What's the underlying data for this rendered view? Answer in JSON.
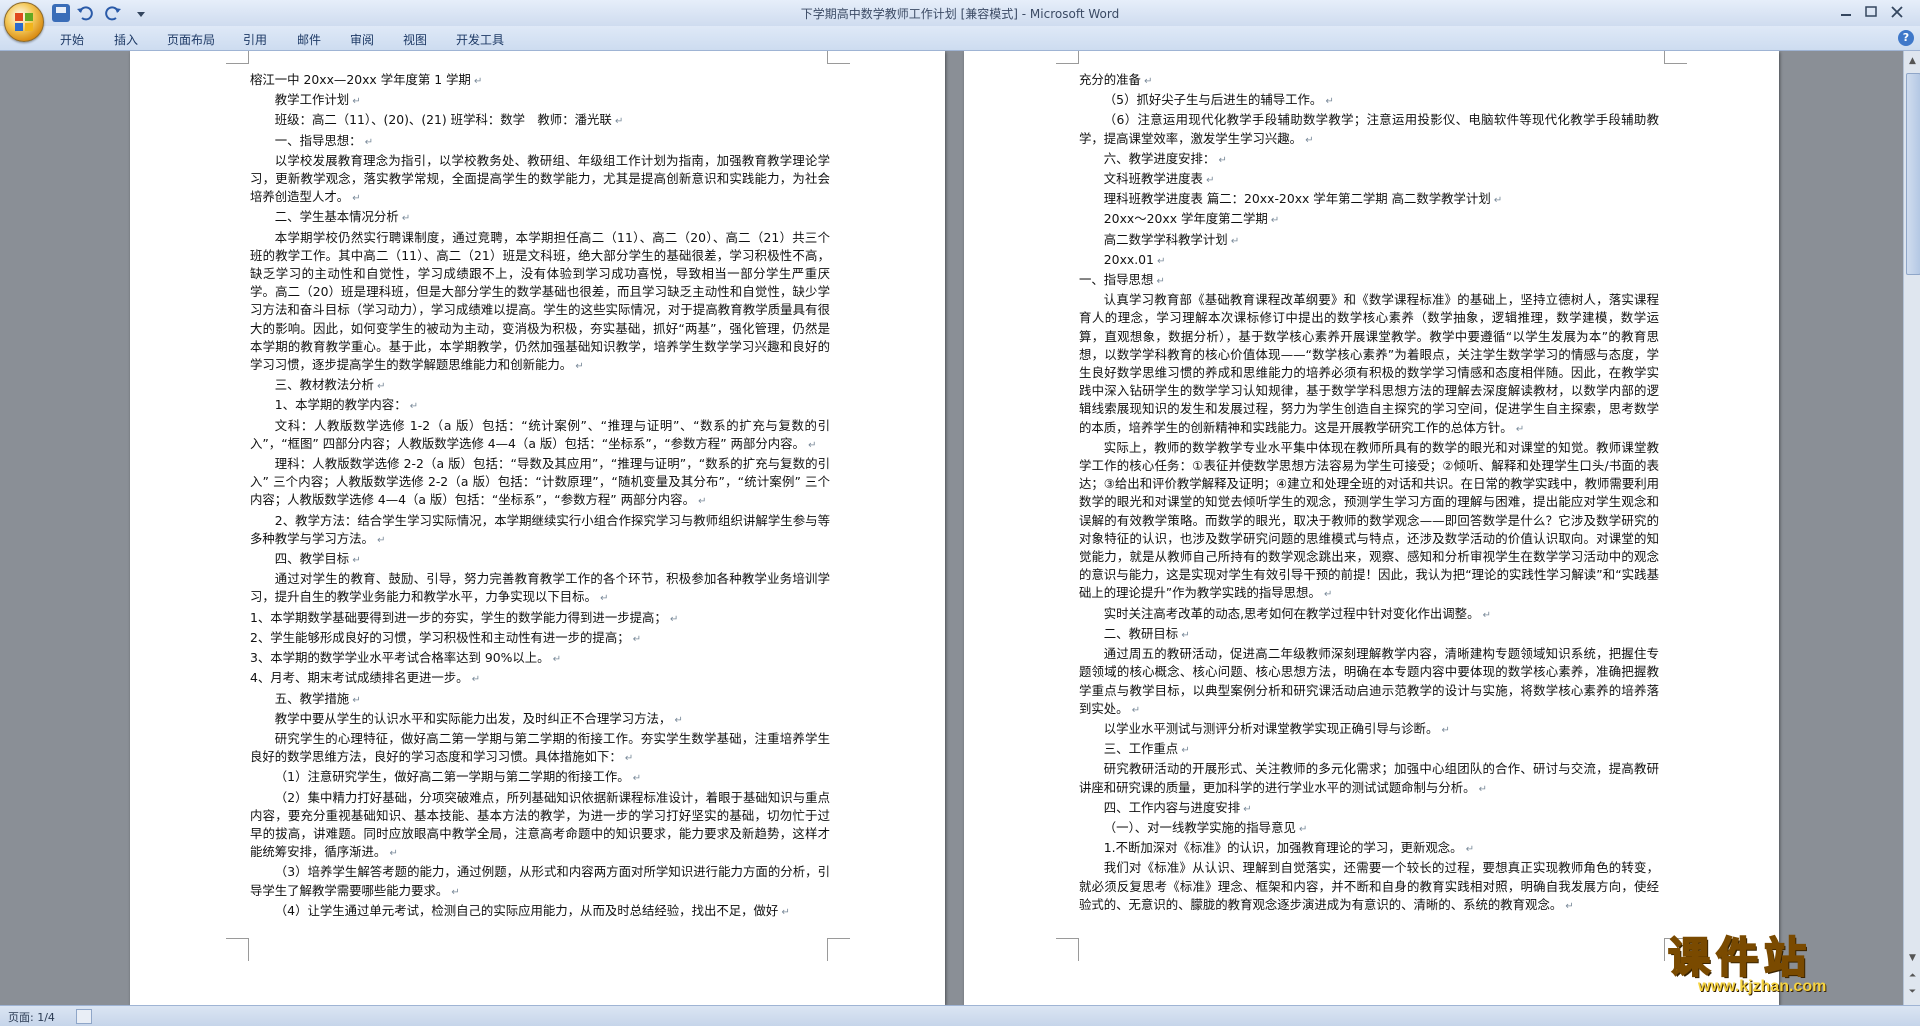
{
  "window": {
    "title": "下学期高中数学教师工作计划 [兼容模式] - Microsoft Word"
  },
  "ribbon": {
    "tabs": [
      "开始",
      "插入",
      "页面布局",
      "引用",
      "邮件",
      "审阅",
      "视图",
      "开发工具"
    ]
  },
  "status": {
    "page": "页面: 1/4"
  },
  "watermark": {
    "main": "课件站",
    "sub": "www.kjzhan.com"
  },
  "page1": [
    {
      "t": "榕江一中 20xx—20xx 学年度第 1 学期",
      "i": false
    },
    {
      "t": "教学工作计划",
      "i": true
    },
    {
      "t": "班级：高二（11）、(20)、(21) 班学科：数学　教师：潘光联",
      "i": true
    },
    {
      "t": "一、指导思想：",
      "i": true
    },
    {
      "t": "以学校发展教育理念为指引，以学校教务处、教研组、年级组工作计划为指南，加强教育教学理论学习，更新教学观念，落实教学常规，全面提高学生的数学能力，尤其是提高创新意识和实践能力，为社会培养创造型人才。",
      "i": true
    },
    {
      "t": "二、学生基本情况分析",
      "i": true
    },
    {
      "t": "本学期学校仍然实行聘课制度，通过竞聘，本学期担任高二（11）、高二（20）、高二（21）共三个班的教学工作。其中高二（11）、高二（21）班是文科班，绝大部分学生的基础很差，学习积极性不高，缺乏学习的主动性和自觉性，学习成绩跟不上，没有体验到学习成功喜悦，导致相当一部分学生严重厌学。高二（20）班是理科班，但是大部分学生的数学基础也很差，而且学习缺乏主动性和自觉性，缺少学习方法和奋斗目标（学习动力），学习成绩难以提高。学生的这些实际情况，对于提高教育教学质量具有很大的影响。因此，如何变学生的被动为主动，变消极为积极，夯实基础，抓好“两基”，强化管理，仍然是本学期的教育教学重心。基于此，本学期教学，仍然加强基础知识教学，培养学生数学学习兴趣和良好的学习习惯，逐步提高学生的数学解题思维能力和创新能力。",
      "i": true
    },
    {
      "t": "三、教材教法分析",
      "i": true
    },
    {
      "t": "1、本学期的教学内容：",
      "i": true
    },
    {
      "t": "文科：人教版数学选修 1-2（a 版）包括：“统计案例”、“推理与证明”、“数系的扩充与复数的引入”，“框图” 四部分内容；人教版数学选修 4—4（a 版）包括：“坐标系”，“参数方程” 两部分内容。",
      "i": true
    },
    {
      "t": "理科：人教版数学选修 2-2（a 版）包括：“导数及其应用”，“推理与证明”，“数系的扩充与复数的引入” 三个内容；人教版数学选修 2-2（a 版）包括：“计数原理”，“随机变量及其分布”，“统计案例” 三个内容；人教版数学选修 4—4（a 版）包括：“坐标系”，“参数方程” 两部分内容。",
      "i": true
    },
    {
      "t": "2、教学方法：结合学生学习实际情况，本学期继续实行小组合作探究学习与教师组织讲解学生参与等多种教学与学习方法。",
      "i": true
    },
    {
      "t": "四、教学目标",
      "i": true
    },
    {
      "t": "通过对学生的教育、鼓励、引导，努力完善教育教学工作的各个环节，积极参加各种教学业务培训学习，提升自生的教学业务能力和教学水平，力争实现以下目标。",
      "i": true
    },
    {
      "t": "1、本学期数学基础要得到进一步的夯实，学生的数学能力得到进一步提高；",
      "i": false
    },
    {
      "t": "2、学生能够形成良好的习惯，学习积极性和主动性有进一步的提高；",
      "i": false
    },
    {
      "t": "3、本学期的数学学业水平考试合格率达到 90%以上。",
      "i": false
    },
    {
      "t": "4、月考、期末考试成绩排名更进一步。",
      "i": false
    },
    {
      "t": "五、教学措施",
      "i": true
    },
    {
      "t": "教学中要从学生的认识水平和实际能力出发，及时纠正不合理学习方法，",
      "i": true
    },
    {
      "t": "研究学生的心理特征，做好高二第一学期与第二学期的衔接工作。夯实学生数学基础，注重培养学生良好的数学思维方法，良好的学习态度和学习习惯。具体措施如下：",
      "i": true
    },
    {
      "t": "（1）注意研究学生，做好高二第一学期与第二学期的衔接工作。",
      "i": true
    },
    {
      "t": "（2）集中精力打好基础，分项突破难点，所列基础知识依据新课程标准设计，着眼于基础知识与重点内容，要充分重视基础知识、基本技能、基本方法的教学，为进一步的学习打好坚实的基础，切勿忙于过早的拔高，讲难题。同时应放眼高中教学全局，注意高考命题中的知识要求，能力要求及新趋势，这样才能统筹安排，循序渐进。",
      "i": true
    },
    {
      "t": "（3）培养学生解答考题的能力，通过例题，从形式和内容两方面对所学知识进行能力方面的分析，引导学生了解教学需要哪些能力要求。",
      "i": true
    },
    {
      "t": "（4）让学生通过单元考试，检测自己的实际应用能力，从而及时总结经验，找出不足，做好",
      "i": true
    }
  ],
  "page2": [
    {
      "t": "充分的准备",
      "i": false
    },
    {
      "t": "（5）抓好尖子生与后进生的辅导工作。",
      "i": true
    },
    {
      "t": "（6）注意运用现代化教学手段辅助数学教学；注意运用投影仪、电脑软件等现代化教学手段辅助教学，提高课堂效率，激发学生学习兴趣。",
      "i": true
    },
    {
      "t": "六、教学进度安排：",
      "i": true
    },
    {
      "t": "文科班教学进度表",
      "i": true
    },
    {
      "t": "理科班教学进度表 篇二：20xx-20xx 学年第二学期 高二数学教学计划",
      "i": true
    },
    {
      "t": "20xx～20xx 学年度第二学期",
      "i": true
    },
    {
      "t": "高二数学学科教学计划",
      "i": true
    },
    {
      "t": "20xx.01",
      "i": true
    },
    {
      "t": "一、指导思想",
      "i": false
    },
    {
      "t": "认真学习教育部《基础教育课程改革纲要》和《数学课程标准》的基础上，坚持立德树人，落实课程育人的理念，学习理解本次课标修订中提出的数学核心素养（数学抽象，逻辑推理，数学建模，数学运算，直观想象，数据分析），基于数学核心素养开展课堂教学。教学中要遵循“以学生发展为本”的教育思想，以数学学科教育的核心价值体现——“数学核心素养”为着眼点，关注学生数学学习的情感与态度，学生良好数学思维习惯的养成和思维能力的培养必须有积极的数学学习情感和态度相伴随。因此，在教学实践中深入钻研学生的数学学习认知规律，基于数学学科思想方法的理解去深度解读教材，以数学内部的逻辑线索展现知识的发生和发展过程，努力为学生创造自主探究的学习空间，促进学生自主探索，思考数学的本质，培养学生的创新精神和实践能力。这是开展教学研究工作的总体方针。",
      "i": true
    },
    {
      "t": "实际上，教师的数学教学专业水平集中体现在教师所具有的数学的眼光和对课堂的知觉。教师课堂教学工作的核心任务：①表征并使数学思想方法容易为学生可接受；②倾听、解释和处理学生口头/书面的表达；③给出和评价教学解释及证明；④建立和处理全班的对话和共识。在日常的教学实践中，教师需要利用数学的眼光和对课堂的知觉去倾听学生的观念，预测学生学习方面的理解与困难，提出能应对学生观念和误解的有效教学策略。而数学的眼光，取决于教师的数学观念——即回答数学是什么？它涉及数学研究的对象特征的认识，也涉及数学研究问题的思维模式与特点，还涉及数学活动的价值认识取向。对课堂的知觉能力，就是从教师自己所持有的数学观念跳出来，观察、感知和分析审视学生在数学学习活动中的观念的意识与能力，这是实现对学生有效引导干预的前提！因此，我认为把“理论的实践性学习解读”和“实践基础上的理论提升”作为教学实践的指导思想。",
      "i": true
    },
    {
      "t": "实时关注高考改革的动态,思考如何在教学过程中针对变化作出调整。",
      "i": true
    },
    {
      "t": "二、教研目标",
      "i": true
    },
    {
      "t": "通过周五的教研活动，促进高二年级教师深刻理解教学内容，清晰建构专题领域知识系统，把握住专题领域的核心概念、核心问题、核心思想方法，明确在本专题内容中要体现的数学核心素养，准确把握教学重点与教学目标，以典型案例分析和研究课活动启迪示范教学的设计与实施，将数学核心素养的培养落到实处。",
      "i": true
    },
    {
      "t": "以学业水平测试与测评分析对课堂教学实现正确引导与诊断。",
      "i": true
    },
    {
      "t": "三、工作重点",
      "i": true
    },
    {
      "t": "研究教研活动的开展形式、关注教师的多元化需求；加强中心组团队的合作、研讨与交流，提高教研讲座和研究课的质量，更加科学的进行学业水平的测试试题命制与分析。",
      "i": true
    },
    {
      "t": "四、工作内容与进度安排",
      "i": true
    },
    {
      "t": "（一）、对一线教学实施的指导意见",
      "i": true
    },
    {
      "t": "1.不断加深对《标准》的认识，加强教育理论的学习，更新观念。",
      "i": true
    },
    {
      "t": "我们对《标准》从认识、理解到自觉落实，还需要一个较长的过程，要想真正实现教师角色的转变，就必须反复思考《标准》理念、框架和内容，并不断和自身的教育实践相对照，明确自我发展方向，使经验式的、无意识的、朦胧的教育观念逐步演进成为有意识的、清晰的、系统的教育观念。",
      "i": true
    }
  ]
}
